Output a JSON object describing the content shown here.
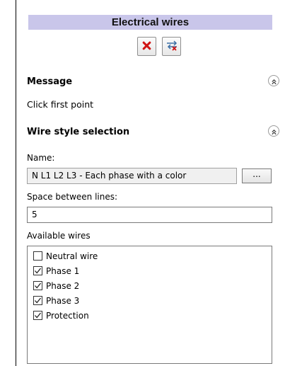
{
  "panel": {
    "title": "Electrical wires",
    "toolbar": [
      {
        "icon": "cancel-x-icon"
      },
      {
        "icon": "swap-cancel-icon"
      }
    ]
  },
  "message_section": {
    "header": "Message",
    "text": "Click first point"
  },
  "wire_style_section": {
    "header": "Wire style selection",
    "name_label": "Name:",
    "name_value": "N L1 L2 L3 - Each phase with a color",
    "browse_label": "...",
    "spacing_label": "Space between lines:",
    "spacing_value": "5",
    "available_label": "Available wires",
    "wires": [
      {
        "label": "Neutral wire",
        "checked": false
      },
      {
        "label": "Phase 1",
        "checked": true
      },
      {
        "label": "Phase 2",
        "checked": true
      },
      {
        "label": "Phase 3",
        "checked": true
      },
      {
        "label": "Protection",
        "checked": true
      }
    ]
  },
  "colors": {
    "title_bar": "#c9c6ea",
    "cancel_icon": "#d01414"
  }
}
